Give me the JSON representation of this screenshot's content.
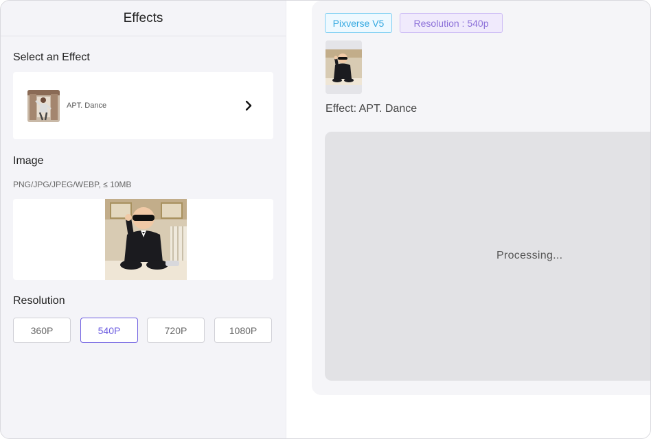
{
  "left_panel": {
    "title": "Effects",
    "select_effect": {
      "heading": "Select an Effect",
      "effect_name": "APT. Dance",
      "chevron_icon": "chevron-right-icon"
    },
    "image": {
      "heading": "Image",
      "hint": "PNG/JPG/JPEG/WEBP, ≤ 10MB"
    },
    "resolution": {
      "heading": "Resolution",
      "options": [
        "360P",
        "540P",
        "720P",
        "1080P"
      ],
      "selected": "540P"
    }
  },
  "right_panel": {
    "model_tag": "Pixverse V5",
    "resolution_tag": "Resolution : 540p",
    "effect_label": "Effect: APT. Dance",
    "status": "Processing..."
  },
  "colors": {
    "accent": "#6b5be0",
    "model_tag_text": "#33a8e0",
    "resolution_tag_text": "#8b6fd8",
    "panel_bg": "#f4f4f8",
    "processing_bg": "#e2e2e5"
  }
}
